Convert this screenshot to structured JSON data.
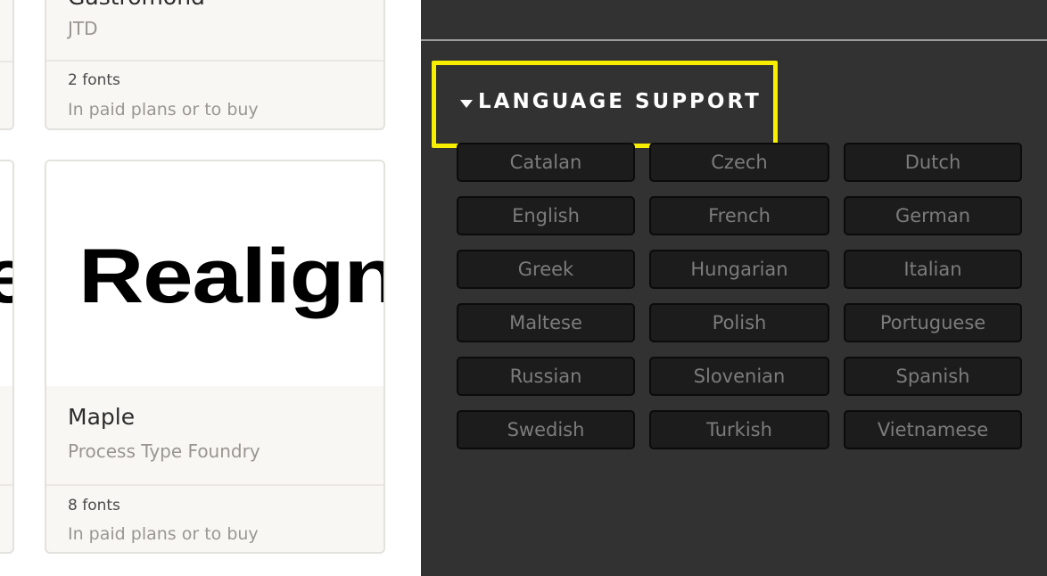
{
  "font_cards": [
    {
      "name": "Gastromond",
      "foundry": "JTD",
      "font_count": "2 fonts",
      "availability": "In paid plans or to buy"
    },
    {
      "sample_text": "Realign",
      "name": "Maple",
      "foundry": "Process Type Foundry",
      "font_count": "8 fonts",
      "availability": "In paid plans or to buy"
    }
  ],
  "left_partial_sample": "e",
  "filter_panel": {
    "section_title": "LANGUAGE SUPPORT",
    "section_expanded": true,
    "highlight_color": "#f7ee00",
    "languages": [
      "Catalan",
      "Czech",
      "Dutch",
      "English",
      "French",
      "German",
      "Greek",
      "Hungarian",
      "Italian",
      "Maltese",
      "Polish",
      "Portuguese",
      "Russian",
      "Slovenian",
      "Spanish",
      "Swedish",
      "Turkish",
      "Vietnamese"
    ]
  }
}
